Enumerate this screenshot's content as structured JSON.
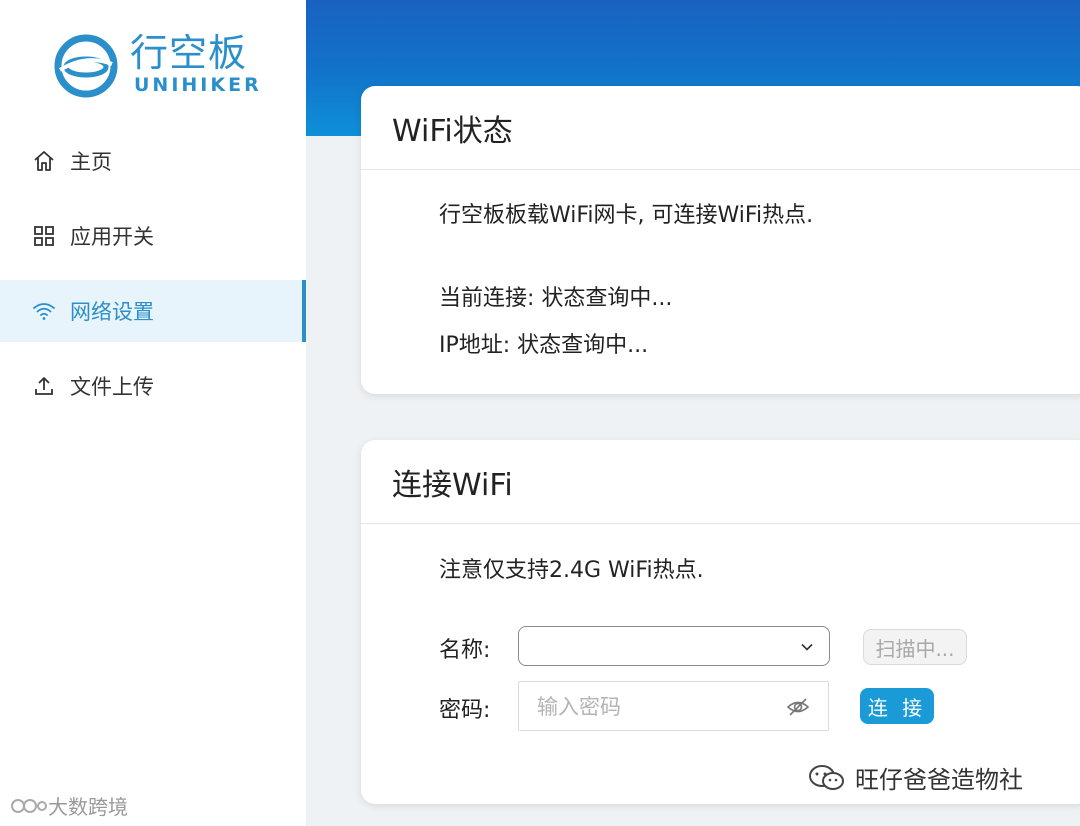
{
  "brand": {
    "title": "行空板",
    "subtitle": "UNIHIKER"
  },
  "colors": {
    "accent": "#2a8fca",
    "banner_top": "#1a62c0",
    "banner_bottom": "#0e90d8",
    "button": "#1a9ad6"
  },
  "sidebar": {
    "items": [
      {
        "label": "主页",
        "icon": "home-icon",
        "active": false
      },
      {
        "label": "应用开关",
        "icon": "grid-icon",
        "active": false
      },
      {
        "label": "网络设置",
        "icon": "wifi-icon",
        "active": true
      },
      {
        "label": "文件上传",
        "icon": "upload-icon",
        "active": false
      }
    ]
  },
  "wifi_status": {
    "title": "WiFi状态",
    "description": "行空板板载WiFi网卡, 可连接WiFi热点.",
    "current_connection": "当前连接: 状态查询中...",
    "ip_address": "IP地址: 状态查询中..."
  },
  "connect_wifi": {
    "title": "连接WiFi",
    "note": "注意仅支持2.4G WiFi热点.",
    "name_label": "名称:",
    "name_value": "",
    "scan_button": "扫描中...",
    "password_label": "密码:",
    "password_placeholder": "输入密码",
    "connect_button": "连 接"
  },
  "watermarks": {
    "left": "大数跨境",
    "right": "旺仔爸爸造物社"
  }
}
